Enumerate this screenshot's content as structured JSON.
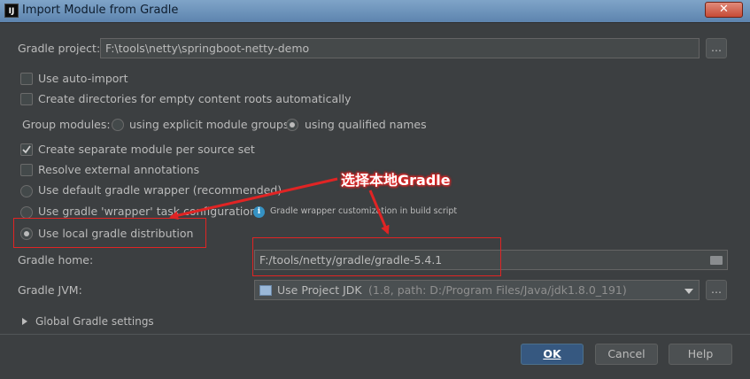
{
  "window": {
    "title": "Import Module from Gradle",
    "app_icon": "IJ",
    "close_glyph": "✕"
  },
  "gradle_project": {
    "label": "Gradle project:",
    "value": "F:\\tools\\netty\\springboot-netty-demo",
    "browse_label": "..."
  },
  "options": {
    "auto_import": {
      "label": "Use auto-import",
      "checked": false
    },
    "create_dirs": {
      "label": "Create directories for empty content roots automatically",
      "checked": false
    },
    "group_modules": {
      "label": "Group modules:",
      "explicit": "using explicit module groups",
      "qualified": "using qualified names",
      "selected": "qualified"
    },
    "separate_module": {
      "label": "Create separate module per source set",
      "checked": true
    },
    "resolve_annotations": {
      "label": "Resolve external annotations",
      "checked": false
    }
  },
  "distribution": {
    "default_wrapper": "Use default gradle wrapper (recommended)",
    "wrapper_task": "Use gradle 'wrapper' task configuration",
    "wrapper_hint": "Gradle wrapper customization in build script",
    "local": "Use local gradle distribution",
    "selected": "local"
  },
  "gradle_home": {
    "label": "Gradle home:",
    "value": "F:/tools/netty/gradle/gradle-5.4.1"
  },
  "gradle_jvm": {
    "label": "Gradle JVM:",
    "selected": "Use Project JDK",
    "detail": "(1.8, path: D:/Program Files/Java/jdk1.8.0_191)",
    "browse_label": "..."
  },
  "global_settings": {
    "label": "Global Gradle settings"
  },
  "buttons": {
    "ok": "OK",
    "cancel": "Cancel",
    "help": "Help"
  },
  "annotation": {
    "text": "选择本地Gradle",
    "color": "#e02424"
  }
}
